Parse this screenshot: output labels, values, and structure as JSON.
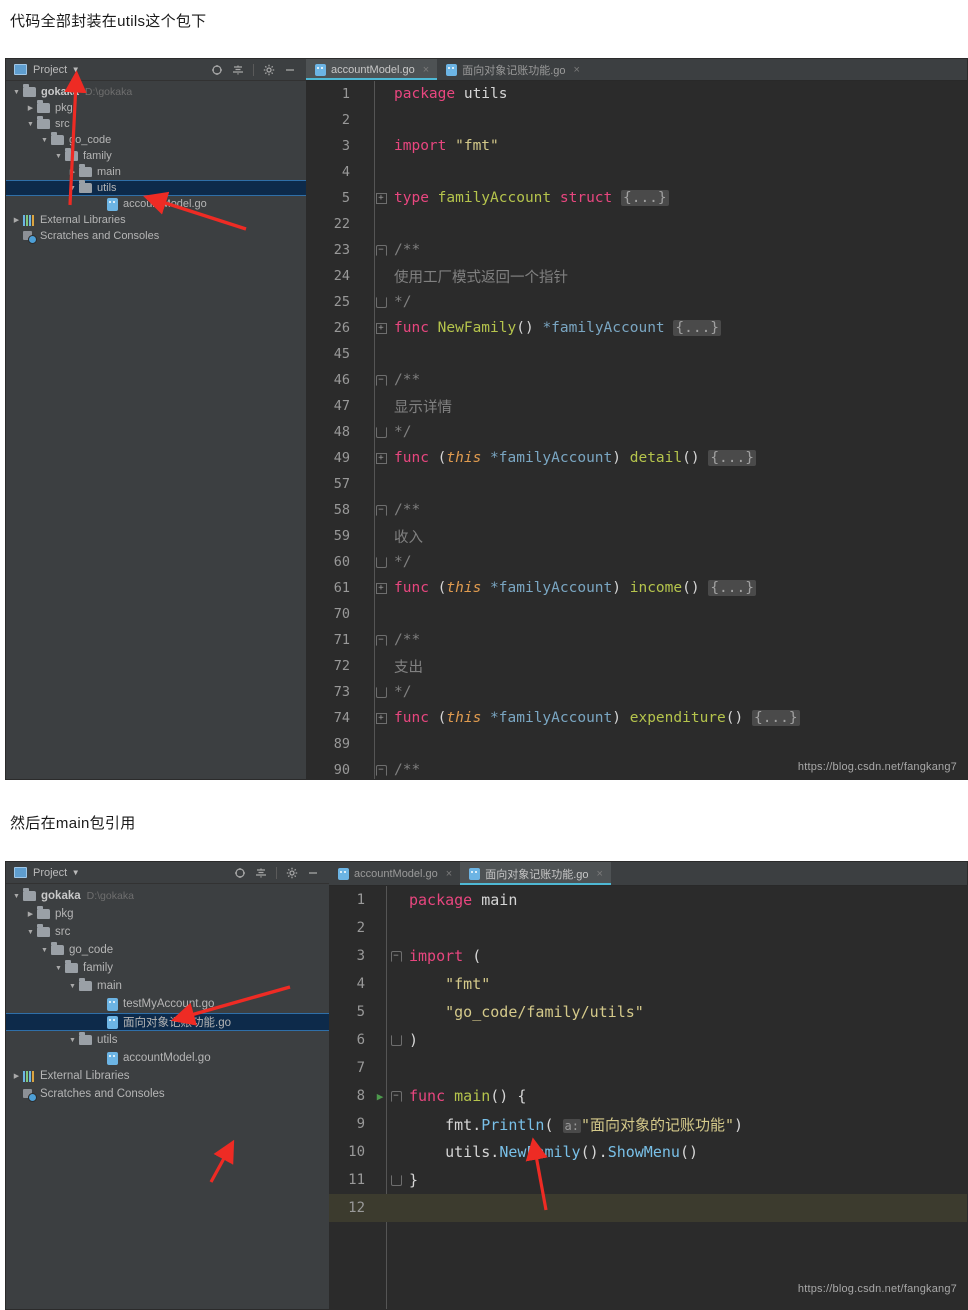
{
  "captions": {
    "first": "代码全部封装在utils这个包下",
    "second": "然后在main包引用"
  },
  "watermark": "https://blog.csdn.net/fangkang7",
  "panel1": {
    "sidebar": {
      "title": "Project",
      "tools": [
        "locate-icon",
        "collapse-all-icon",
        "settings-gear-icon",
        "minimize-icon"
      ],
      "tree": [
        {
          "label": "gokaka",
          "path": "D:\\gokaka",
          "icon": "folder-icon",
          "twisty": "down",
          "indent": 0,
          "bold": true,
          "selected": false
        },
        {
          "label": "pkg",
          "path": "",
          "icon": "folder-icon",
          "twisty": "right",
          "indent": 1,
          "bold": false,
          "selected": false
        },
        {
          "label": "src",
          "path": "",
          "icon": "folder-icon",
          "twisty": "down",
          "indent": 1,
          "bold": false,
          "selected": false
        },
        {
          "label": "go_code",
          "path": "",
          "icon": "folder-icon",
          "twisty": "down",
          "indent": 2,
          "bold": false,
          "selected": false
        },
        {
          "label": "family",
          "path": "",
          "icon": "folder-icon",
          "twisty": "down",
          "indent": 3,
          "bold": false,
          "selected": false
        },
        {
          "label": "main",
          "path": "",
          "icon": "folder-icon",
          "twisty": "right",
          "indent": 4,
          "bold": false,
          "selected": false
        },
        {
          "label": "utils",
          "path": "",
          "icon": "folder-icon",
          "twisty": "down",
          "indent": 4,
          "bold": false,
          "selected": true
        },
        {
          "label": "accountModel.go",
          "path": "",
          "icon": "go-file-icon",
          "twisty": "",
          "indent": 6,
          "bold": false,
          "selected": false
        },
        {
          "label": "External Libraries",
          "path": "",
          "icon": "libraries-icon",
          "twisty": "right",
          "indent": 0,
          "bold": false,
          "selected": false
        },
        {
          "label": "Scratches and Consoles",
          "path": "",
          "icon": "scratches-icon",
          "twisty": "",
          "indent": 0,
          "bold": false,
          "selected": false
        }
      ]
    },
    "tabs": [
      {
        "label": "accountModel.go",
        "active": true
      },
      {
        "label": "面向对象记账功能.go",
        "active": false
      }
    ],
    "code_lines": [
      {
        "num": "1",
        "fold": "",
        "run": false,
        "tokens": [
          {
            "t": "package ",
            "c": "kw2"
          },
          {
            "t": "utils",
            "c": "plain"
          }
        ]
      },
      {
        "num": "2",
        "fold": "",
        "run": false,
        "tokens": []
      },
      {
        "num": "3",
        "fold": "",
        "run": false,
        "tokens": [
          {
            "t": "import ",
            "c": "kw2"
          },
          {
            "t": "\"fmt\"",
            "c": "str"
          }
        ]
      },
      {
        "num": "4",
        "fold": "",
        "run": false,
        "tokens": []
      },
      {
        "num": "5",
        "fold": "plus",
        "run": false,
        "tokens": [
          {
            "t": "type ",
            "c": "kw2"
          },
          {
            "t": "familyAccount ",
            "c": "typ"
          },
          {
            "t": "struct ",
            "c": "kw2"
          },
          {
            "t": "{...}",
            "c": "fold-ph"
          }
        ]
      },
      {
        "num": "22",
        "fold": "",
        "run": false,
        "tokens": []
      },
      {
        "num": "23",
        "fold": "cstart",
        "run": false,
        "tokens": [
          {
            "t": "/**",
            "c": "cmt"
          }
        ]
      },
      {
        "num": "24",
        "fold": "",
        "run": false,
        "tokens": [
          {
            "t": "使用工厂模式返回一个指针",
            "c": "cmt"
          }
        ]
      },
      {
        "num": "25",
        "fold": "cend",
        "run": false,
        "tokens": [
          {
            "t": "*/",
            "c": "cmt"
          }
        ]
      },
      {
        "num": "26",
        "fold": "plus",
        "run": false,
        "tokens": [
          {
            "t": "func ",
            "c": "kw2"
          },
          {
            "t": "NewFamily",
            "c": "fn"
          },
          {
            "t": "() ",
            "c": "plain"
          },
          {
            "t": "*familyAccount ",
            "c": "ptr"
          },
          {
            "t": "{...}",
            "c": "fold-ph"
          }
        ]
      },
      {
        "num": "45",
        "fold": "",
        "run": false,
        "tokens": []
      },
      {
        "num": "46",
        "fold": "cstart",
        "run": false,
        "tokens": [
          {
            "t": "/**",
            "c": "cmt"
          }
        ]
      },
      {
        "num": "47",
        "fold": "",
        "run": false,
        "tokens": [
          {
            "t": "显示详情",
            "c": "cmt"
          }
        ]
      },
      {
        "num": "48",
        "fold": "cend",
        "run": false,
        "tokens": [
          {
            "t": "*/",
            "c": "cmt"
          }
        ]
      },
      {
        "num": "49",
        "fold": "plus",
        "run": false,
        "tokens": [
          {
            "t": "func ",
            "c": "kw2"
          },
          {
            "t": "(",
            "c": "plain"
          },
          {
            "t": "this",
            "c": "ital"
          },
          {
            "t": " *familyAccount",
            "c": "ptr"
          },
          {
            "t": ") ",
            "c": "plain"
          },
          {
            "t": "detail",
            "c": "fn"
          },
          {
            "t": "() ",
            "c": "plain"
          },
          {
            "t": "{...}",
            "c": "fold-ph"
          }
        ]
      },
      {
        "num": "57",
        "fold": "",
        "run": false,
        "tokens": []
      },
      {
        "num": "58",
        "fold": "cstart",
        "run": false,
        "tokens": [
          {
            "t": "/**",
            "c": "cmt"
          }
        ]
      },
      {
        "num": "59",
        "fold": "",
        "run": false,
        "tokens": [
          {
            "t": "收入",
            "c": "cmt"
          }
        ]
      },
      {
        "num": "60",
        "fold": "cend",
        "run": false,
        "tokens": [
          {
            "t": "*/",
            "c": "cmt"
          }
        ]
      },
      {
        "num": "61",
        "fold": "plus",
        "run": false,
        "tokens": [
          {
            "t": "func ",
            "c": "kw2"
          },
          {
            "t": "(",
            "c": "plain"
          },
          {
            "t": "this",
            "c": "ital"
          },
          {
            "t": " *familyAccount",
            "c": "ptr"
          },
          {
            "t": ") ",
            "c": "plain"
          },
          {
            "t": "income",
            "c": "fn"
          },
          {
            "t": "() ",
            "c": "plain"
          },
          {
            "t": "{...}",
            "c": "fold-ph"
          }
        ]
      },
      {
        "num": "70",
        "fold": "",
        "run": false,
        "tokens": []
      },
      {
        "num": "71",
        "fold": "cstart",
        "run": false,
        "tokens": [
          {
            "t": "/**",
            "c": "cmt"
          }
        ]
      },
      {
        "num": "72",
        "fold": "",
        "run": false,
        "tokens": [
          {
            "t": "支出",
            "c": "cmt"
          }
        ]
      },
      {
        "num": "73",
        "fold": "cend",
        "run": false,
        "tokens": [
          {
            "t": "*/",
            "c": "cmt"
          }
        ]
      },
      {
        "num": "74",
        "fold": "plus",
        "run": false,
        "tokens": [
          {
            "t": "func ",
            "c": "kw2"
          },
          {
            "t": "(",
            "c": "plain"
          },
          {
            "t": "this",
            "c": "ital"
          },
          {
            "t": " *familyAccount",
            "c": "ptr"
          },
          {
            "t": ") ",
            "c": "plain"
          },
          {
            "t": "expenditure",
            "c": "fn"
          },
          {
            "t": "() ",
            "c": "plain"
          },
          {
            "t": "{...}",
            "c": "fold-ph"
          }
        ]
      },
      {
        "num": "89",
        "fold": "",
        "run": false,
        "tokens": []
      },
      {
        "num": "90",
        "fold": "cstart",
        "run": false,
        "tokens": [
          {
            "t": "/**",
            "c": "cmt"
          }
        ]
      }
    ]
  },
  "panel2": {
    "sidebar": {
      "title": "Project",
      "tools": [
        "locate-icon",
        "collapse-all-icon",
        "settings-gear-icon",
        "minimize-icon"
      ],
      "tree": [
        {
          "label": "gokaka",
          "path": "D:\\gokaka",
          "icon": "folder-icon",
          "twisty": "down",
          "indent": 0,
          "bold": true,
          "selected": false
        },
        {
          "label": "pkg",
          "path": "",
          "icon": "folder-icon",
          "twisty": "right",
          "indent": 1,
          "bold": false,
          "selected": false
        },
        {
          "label": "src",
          "path": "",
          "icon": "folder-icon",
          "twisty": "down",
          "indent": 1,
          "bold": false,
          "selected": false
        },
        {
          "label": "go_code",
          "path": "",
          "icon": "folder-icon",
          "twisty": "down",
          "indent": 2,
          "bold": false,
          "selected": false
        },
        {
          "label": "family",
          "path": "",
          "icon": "folder-icon",
          "twisty": "down",
          "indent": 3,
          "bold": false,
          "selected": false
        },
        {
          "label": "main",
          "path": "",
          "icon": "folder-icon",
          "twisty": "down",
          "indent": 4,
          "bold": false,
          "selected": false
        },
        {
          "label": "testMyAccount.go",
          "path": "",
          "icon": "go-file-icon",
          "twisty": "",
          "indent": 6,
          "bold": false,
          "selected": false
        },
        {
          "label": "面向对象记账功能.go",
          "path": "",
          "icon": "go-file-icon",
          "twisty": "",
          "indent": 6,
          "bold": false,
          "selected": true
        },
        {
          "label": "utils",
          "path": "",
          "icon": "folder-icon",
          "twisty": "down",
          "indent": 4,
          "bold": false,
          "selected": false
        },
        {
          "label": "accountModel.go",
          "path": "",
          "icon": "go-file-icon",
          "twisty": "",
          "indent": 6,
          "bold": false,
          "selected": false
        },
        {
          "label": "External Libraries",
          "path": "",
          "icon": "libraries-icon",
          "twisty": "right",
          "indent": 0,
          "bold": false,
          "selected": false
        },
        {
          "label": "Scratches and Consoles",
          "path": "",
          "icon": "scratches-icon",
          "twisty": "",
          "indent": 0,
          "bold": false,
          "selected": false
        }
      ]
    },
    "tabs": [
      {
        "label": "accountModel.go",
        "active": false
      },
      {
        "label": "面向对象记账功能.go",
        "active": true
      }
    ],
    "code_lines": [
      {
        "num": "1",
        "fold": "",
        "run": false,
        "current": false,
        "tokens": [
          {
            "t": "package ",
            "c": "kw2"
          },
          {
            "t": "main",
            "c": "plain"
          }
        ]
      },
      {
        "num": "2",
        "fold": "",
        "run": false,
        "current": false,
        "tokens": []
      },
      {
        "num": "3",
        "fold": "cstart",
        "run": false,
        "current": false,
        "tokens": [
          {
            "t": "import ",
            "c": "kw2"
          },
          {
            "t": "(",
            "c": "plain"
          }
        ]
      },
      {
        "num": "4",
        "fold": "",
        "run": false,
        "current": false,
        "tokens": [
          {
            "t": "    \"fmt\"",
            "c": "str"
          }
        ]
      },
      {
        "num": "5",
        "fold": "",
        "run": false,
        "current": false,
        "tokens": [
          {
            "t": "    \"go_code/family/utils\"",
            "c": "str"
          }
        ]
      },
      {
        "num": "6",
        "fold": "cend",
        "run": false,
        "current": false,
        "tokens": [
          {
            "t": ")",
            "c": "plain"
          }
        ]
      },
      {
        "num": "7",
        "fold": "",
        "run": false,
        "current": false,
        "tokens": []
      },
      {
        "num": "8",
        "fold": "cstart",
        "run": true,
        "current": false,
        "tokens": [
          {
            "t": "func ",
            "c": "kw2"
          },
          {
            "t": "main",
            "c": "fn"
          },
          {
            "t": "() {",
            "c": "plain"
          }
        ]
      },
      {
        "num": "9",
        "fold": "",
        "run": false,
        "current": false,
        "tokens": [
          {
            "t": "    fmt.",
            "c": "plain"
          },
          {
            "t": "Println",
            "c": "call"
          },
          {
            "t": "( ",
            "c": "plain"
          },
          {
            "t": "a:",
            "c": "inlay"
          },
          {
            "t": "\"面向对象的记账功能\"",
            "c": "str"
          },
          {
            "t": ")",
            "c": "plain"
          }
        ]
      },
      {
        "num": "10",
        "fold": "",
        "run": false,
        "current": false,
        "tokens": [
          {
            "t": "    utils.",
            "c": "plain"
          },
          {
            "t": "NewFamily",
            "c": "call"
          },
          {
            "t": "().",
            "c": "plain"
          },
          {
            "t": "ShowMenu",
            "c": "call"
          },
          {
            "t": "()",
            "c": "plain"
          }
        ]
      },
      {
        "num": "11",
        "fold": "cend",
        "run": false,
        "current": false,
        "tokens": [
          {
            "t": "}",
            "c": "plain"
          }
        ]
      },
      {
        "num": "12",
        "fold": "",
        "run": false,
        "current": true,
        "tokens": []
      }
    ]
  },
  "colors": {
    "editor_bg": "#2b2b2b",
    "panel_bg": "#3c3f41",
    "accent_tab": "#4eb8d4",
    "selection": "#0d2a4a",
    "arrow_red": "#ee2b24",
    "keyword": "#e8467f",
    "type_name": "#b5c44c",
    "string": "#d4c98a",
    "comment": "#808080",
    "call": "#79c0e8",
    "current_line": "#3c3b2e"
  }
}
